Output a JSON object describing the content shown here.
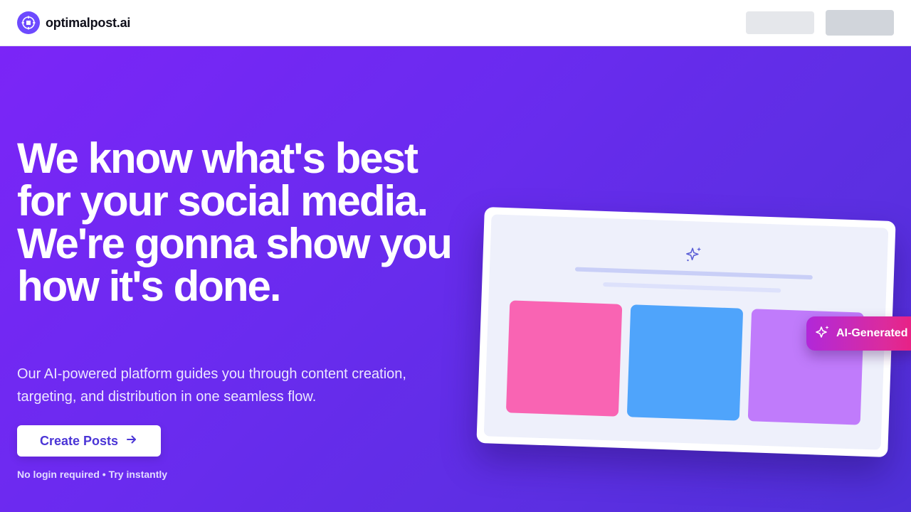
{
  "header": {
    "brand_name": "optimalpost.ai",
    "logo_icon": "logo-icon"
  },
  "hero": {
    "title": "We know what's best for your social media. We're gonna show you how it's done.",
    "subtitle": "Our AI-powered platform guides you through content creation, targeting, and distribution in one seamless flow.",
    "cta_label": "Create Posts",
    "cta_icon": "arrow-right-icon",
    "note": "No login required • Try instantly"
  },
  "mockup": {
    "sparkle_icon": "sparkle-icon",
    "tile_colors": [
      "#f964b3",
      "#4fa4fb",
      "#c07bfb"
    ]
  },
  "badge": {
    "label": "AI-Generated",
    "icon": "sparkle-icon"
  },
  "colors": {
    "accent": "#6d4aff",
    "cta_text": "#4b35d6",
    "hero_gradient_start": "#7b25f7",
    "hero_gradient_end": "#4f30d8"
  }
}
